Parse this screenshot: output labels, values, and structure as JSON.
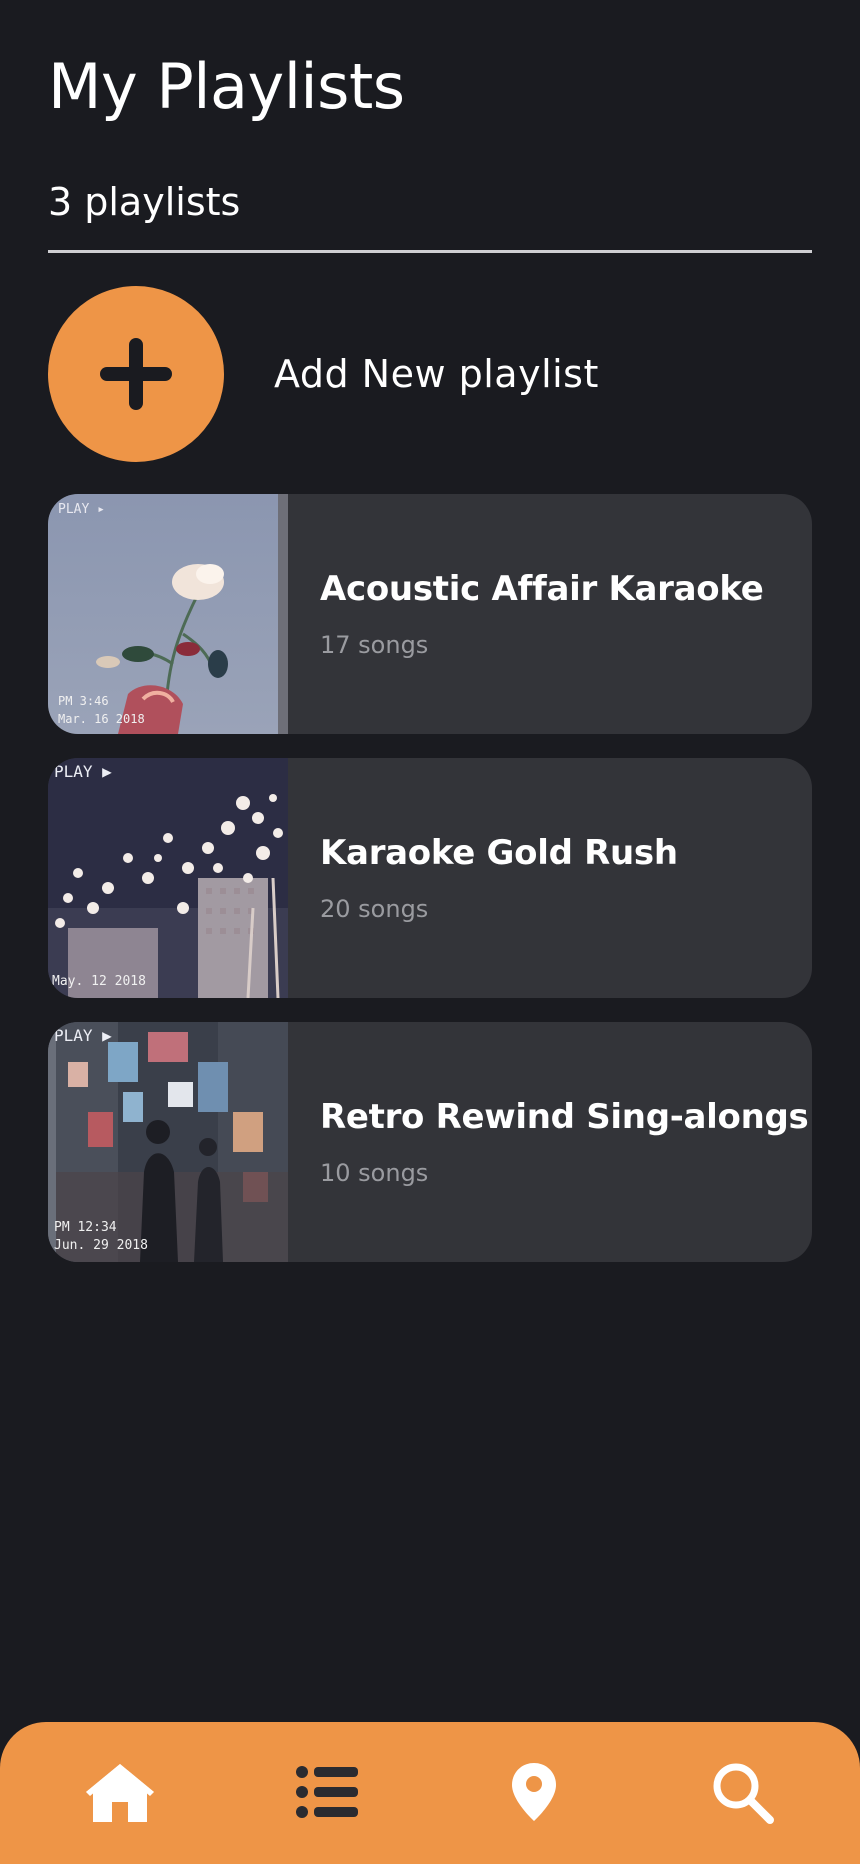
{
  "header": {
    "title": "My Playlists",
    "count_label": "3 playlists"
  },
  "add_playlist": {
    "label": "Add New playlist",
    "icon": "plus-icon"
  },
  "playlists": [
    {
      "name": "Acoustic Affair Karaoke",
      "songs": "17 songs"
    },
    {
      "name": "Karaoke Gold Rush",
      "songs": "20 songs"
    },
    {
      "name": "Retro Rewind Sing-alongs",
      "songs": "10 songs"
    }
  ],
  "thumbnail_overlays": [
    {
      "play": "PLAY ▸",
      "time": "PM 3:46",
      "date": "Mar. 16 2018"
    },
    {
      "play": "PLAY ▶",
      "date": "May. 12 2018"
    },
    {
      "play": "PLAY ▶",
      "time": "PM 12:34",
      "date": "Jun. 29 2018"
    }
  ],
  "bottom_nav": [
    {
      "icon": "home-icon",
      "active": true
    },
    {
      "icon": "list-icon",
      "active": false
    },
    {
      "icon": "location-pin-icon",
      "active": true
    },
    {
      "icon": "search-icon",
      "active": true
    }
  ],
  "colors": {
    "background": "#1a1b20",
    "card": "#333439",
    "accent": "#ee9547",
    "muted_text": "#9a9ba0"
  }
}
